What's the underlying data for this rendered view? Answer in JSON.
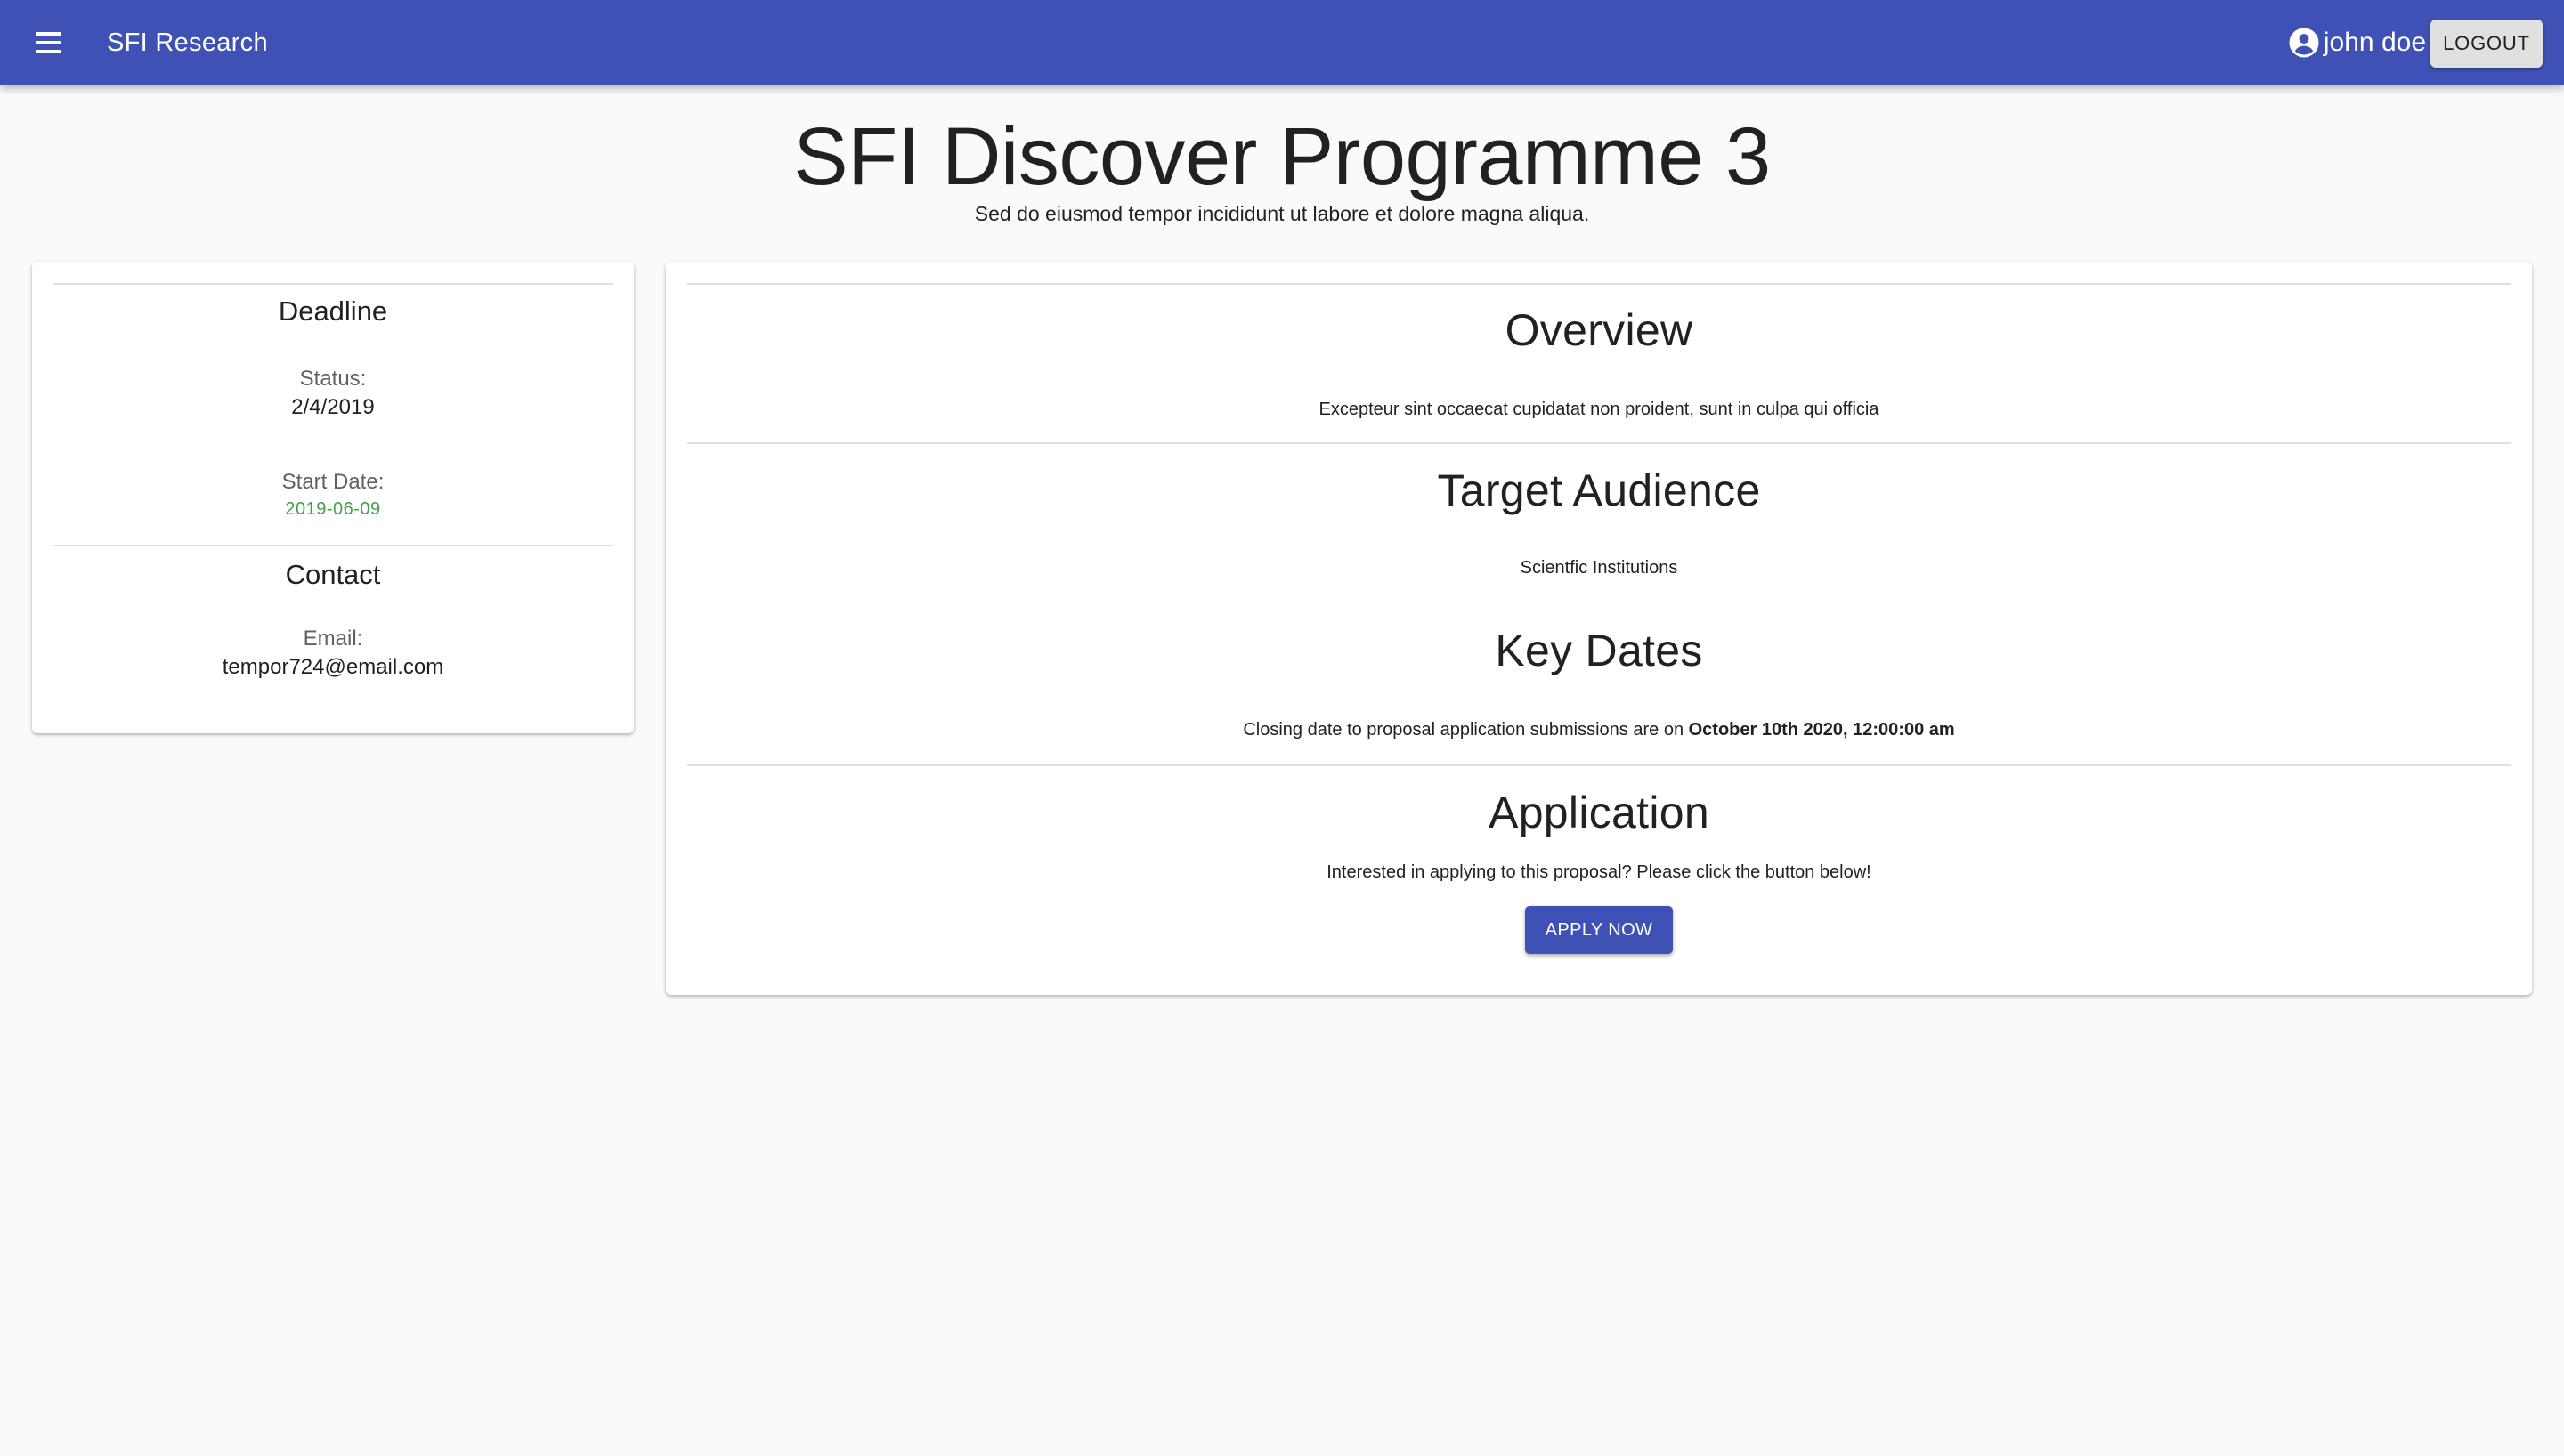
{
  "appbar": {
    "menu_icon": "menu-icon",
    "title": "SFI Research",
    "user_icon": "account-circle-icon",
    "user_name": "john doe",
    "logout_label": "LOGOUT"
  },
  "page": {
    "title": "SFI Discover Programme 3",
    "subtitle": "Sed do eiusmod tempor incididunt ut labore et dolore magna aliqua."
  },
  "sidebar": {
    "deadline_heading": "Deadline",
    "status_label": "Status:",
    "status_value": "2/4/2019",
    "start_date_label": "Start Date:",
    "start_date_value": "2019-06-09",
    "contact_heading": "Contact",
    "email_label": "Email:",
    "email_value": "tempor724@email.com"
  },
  "main": {
    "overview_heading": "Overview",
    "overview_text": "Excepteur sint occaecat cupidatat non proident, sunt in culpa qui officia",
    "audience_heading": "Target Audience",
    "audience_text": "Scientfic Institutions",
    "key_dates_heading": "Key Dates",
    "key_dates_prefix": "Closing date to proposal application submissions are on ",
    "key_dates_date": "October 10th 2020, 12:00:00 am",
    "application_heading": "Application",
    "application_text": "Interested in applying to this proposal? Please click the button below!",
    "apply_label": "APPLY NOW"
  },
  "colors": {
    "primary": "#3f51b5",
    "success": "#43a047",
    "background": "#fafafa"
  }
}
